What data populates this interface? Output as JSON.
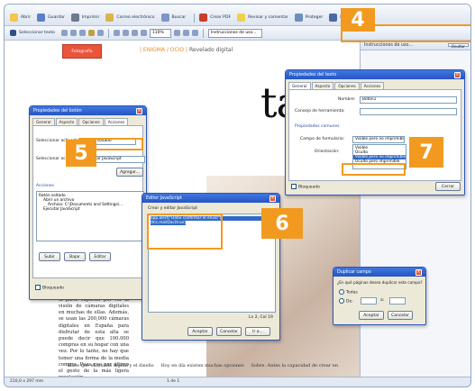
{
  "toolbar1": {
    "items": [
      "Abrir",
      "Guardar",
      "Imprimir",
      "Correo electrónico",
      "Buscar",
      "Crear PDF",
      "Revisar y comentar",
      "Proteger",
      "Firmar"
    ]
  },
  "toolbar2": {
    "select_text": "Seleccionar texto",
    "zoom_value": "110%",
    "search_placeholder": "Instrucciones de uso..."
  },
  "right_panel": {
    "title": "Instrucciones de uso...",
    "close_label": "Ocultar"
  },
  "document": {
    "chapter_badge": "Fotografía",
    "header_bracket": "| ENIGMA / OCIO |",
    "header_text": "Revelado digital",
    "big_title_fragment": "tal",
    "body_text": "producen una descarga por el mismo dispositivo. Los paneles ofrecen incluido y todas las opciones de uso en la parte superior por ver la visión de cámaras digitales en muchas de ellas. Además, se usan las 200,000 cámaras digitales en España para disfrutar de esta alta se puede decir que 100.000 compras en su hogar con una vez. Por lo tanto, no hay que temer una forma de la media compra. Pues que por último el gesto de la más ligera revelación.",
    "foot_left": "Hace que el mundo digital y el diseño",
    "foot_mid": "Hoy en día existen muchas opciones",
    "foot_right": "Sobre. Antes la capacidad de crear en"
  },
  "status_bar": {
    "text": "210,0 x 297 mm",
    "page": "1 de 1"
  },
  "dialog_button_props": {
    "title": "Propiedades del botón",
    "tabs": [
      "General",
      "Aspecto",
      "Opciones",
      "Acciones"
    ],
    "trigger_label": "Seleccionar activador:",
    "trigger_value": "Ratón soltado",
    "action_label": "Seleccionar acción:",
    "action_value": "Ejecutar JavaScript",
    "add_button": "Agregar...",
    "actions_header": "Acciones",
    "tree": [
      "Ratón soltado",
      "Abrir un archivo",
      "Archivo: C:\\Documents and Settings\\...",
      "Ejecutar JavaScript"
    ],
    "up_button": "Subir",
    "down_button": "Bajar",
    "edit_button": "Editar",
    "locked_label": "Bloqueado"
  },
  "dialog_js_editor": {
    "title": "Editor JavaScript",
    "header": "Crear y editar JavaScript",
    "code_lines": [
      "app.alert(\"Debe confirmar el envío\")",
      "this.mailDoc(true)"
    ],
    "line_col": "Ln 2, Col 19",
    "accept_button": "Aceptar",
    "cancel_button": "Cancelar",
    "goto_button": "Ir a..."
  },
  "dialog_text_props": {
    "title": "Propiedades del texto",
    "tabs": [
      "General",
      "Aspecto",
      "Opciones",
      "Acciones"
    ],
    "name_label": "Nombre:",
    "name_value": "Botón1",
    "tooltip_label": "Consejo de herramienta:",
    "common_header": "Propiedades comunes",
    "form_field_label": "Campo de formulario:",
    "form_field_value": "Visible pero no imprimible",
    "orientation_label": "Orientación:",
    "orientation_value": "0",
    "dropdown_options": [
      "Visible",
      "Oculto",
      "Visible pero no imprimible",
      "Oculto pero imprimible"
    ],
    "dropdown_selected_index": 2,
    "locked_label": "Bloqueado",
    "close_button": "Cerrar"
  },
  "dialog_duplicate": {
    "title": "Duplicar campo",
    "question": "¿En qué páginas desea duplicar este campo?",
    "option_all": "Todas",
    "option_from": "De:",
    "option_to": "a:",
    "accept_button": "Aceptar",
    "cancel_button": "Cancelar"
  },
  "callouts": {
    "c4": "4",
    "c5": "5",
    "c6": "6",
    "c7": "7"
  },
  "colors": {
    "callout": "#f29a1f",
    "titlebar": "#2654c4",
    "dialog_bg": "#ece9d8",
    "badge": "#e9543a"
  }
}
